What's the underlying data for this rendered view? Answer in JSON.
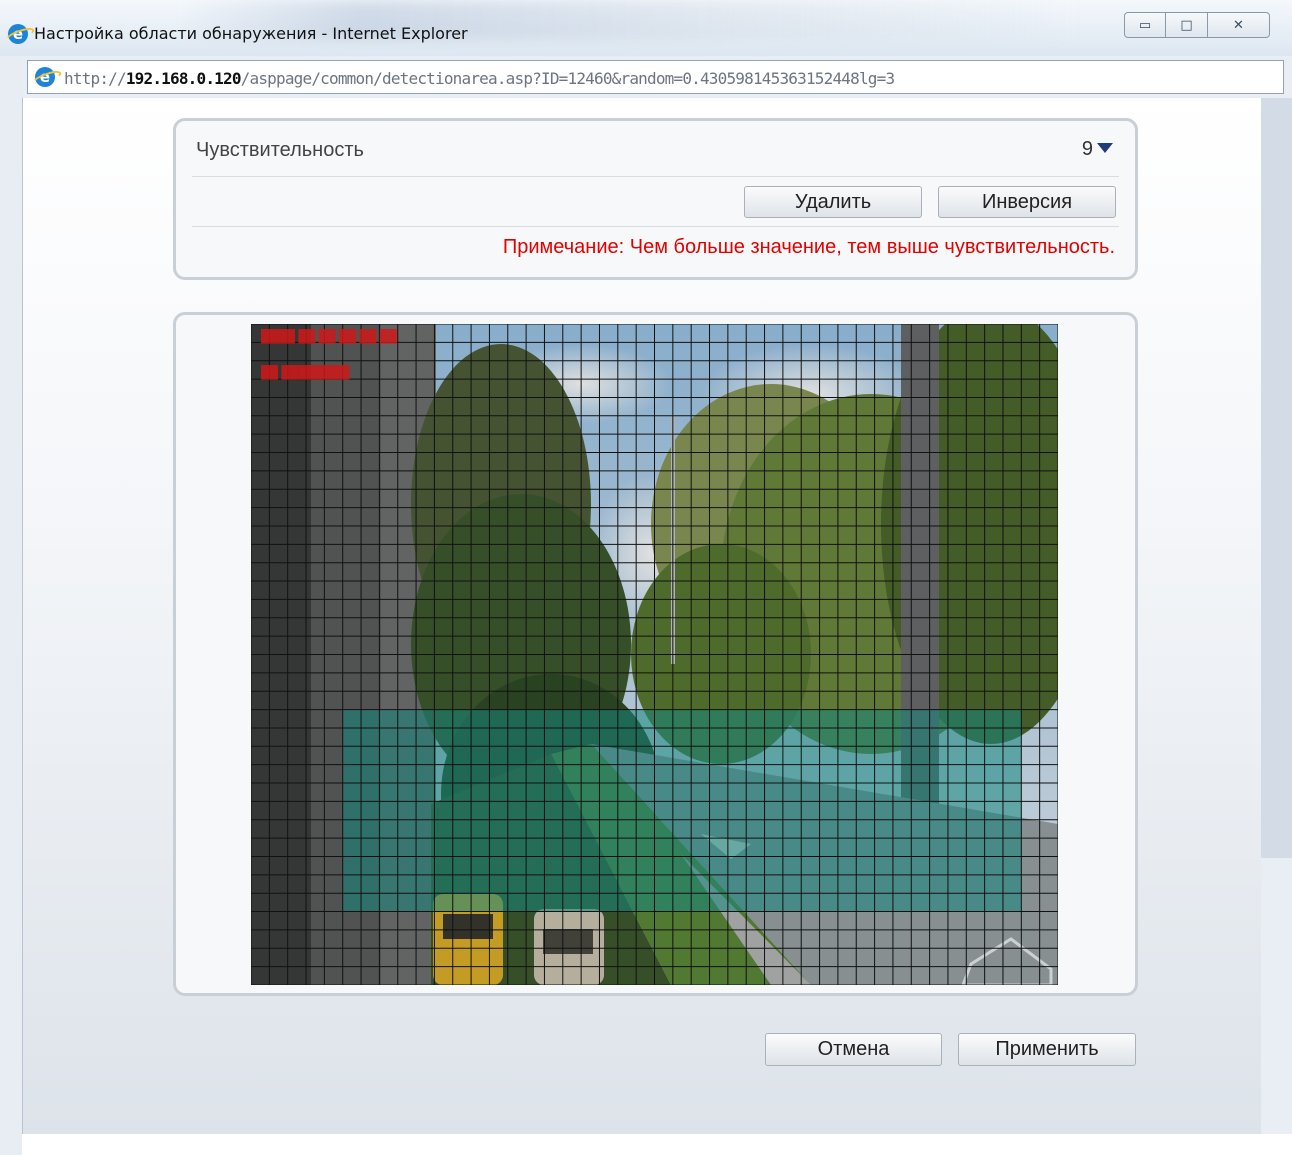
{
  "window": {
    "title": "Настройка области обнаружения - Internet Explorer",
    "ie_icon": "internet-explorer-icon",
    "controls": [
      "minimize-icon",
      "maximize-icon",
      "close-icon"
    ],
    "minimize_glyph": "▭",
    "maximize_glyph": "□",
    "close_glyph": "✕"
  },
  "address": {
    "prefix": "http://",
    "host": "192.168.0.120",
    "path": "/asppage/common/detectionarea.asp?ID=12460&random=0.430598145363152448lg=3"
  },
  "settings": {
    "sensitivity_label": "Чувствительность",
    "sensitivity_value": "9",
    "delete_label": "Удалить",
    "invert_label": "Инверсия",
    "note": "Примечание: Чем больше значение, тем выше чувствительность."
  },
  "grid": {
    "columns": 44,
    "rows": 36,
    "selected_area": {
      "col_start": 5,
      "col_end": 42,
      "row_start": 21,
      "row_end": 32
    },
    "grid_color": "#111111",
    "selected_color": "#1a9a90"
  },
  "footer": {
    "cancel_label": "Отмена",
    "apply_label": "Применить"
  }
}
